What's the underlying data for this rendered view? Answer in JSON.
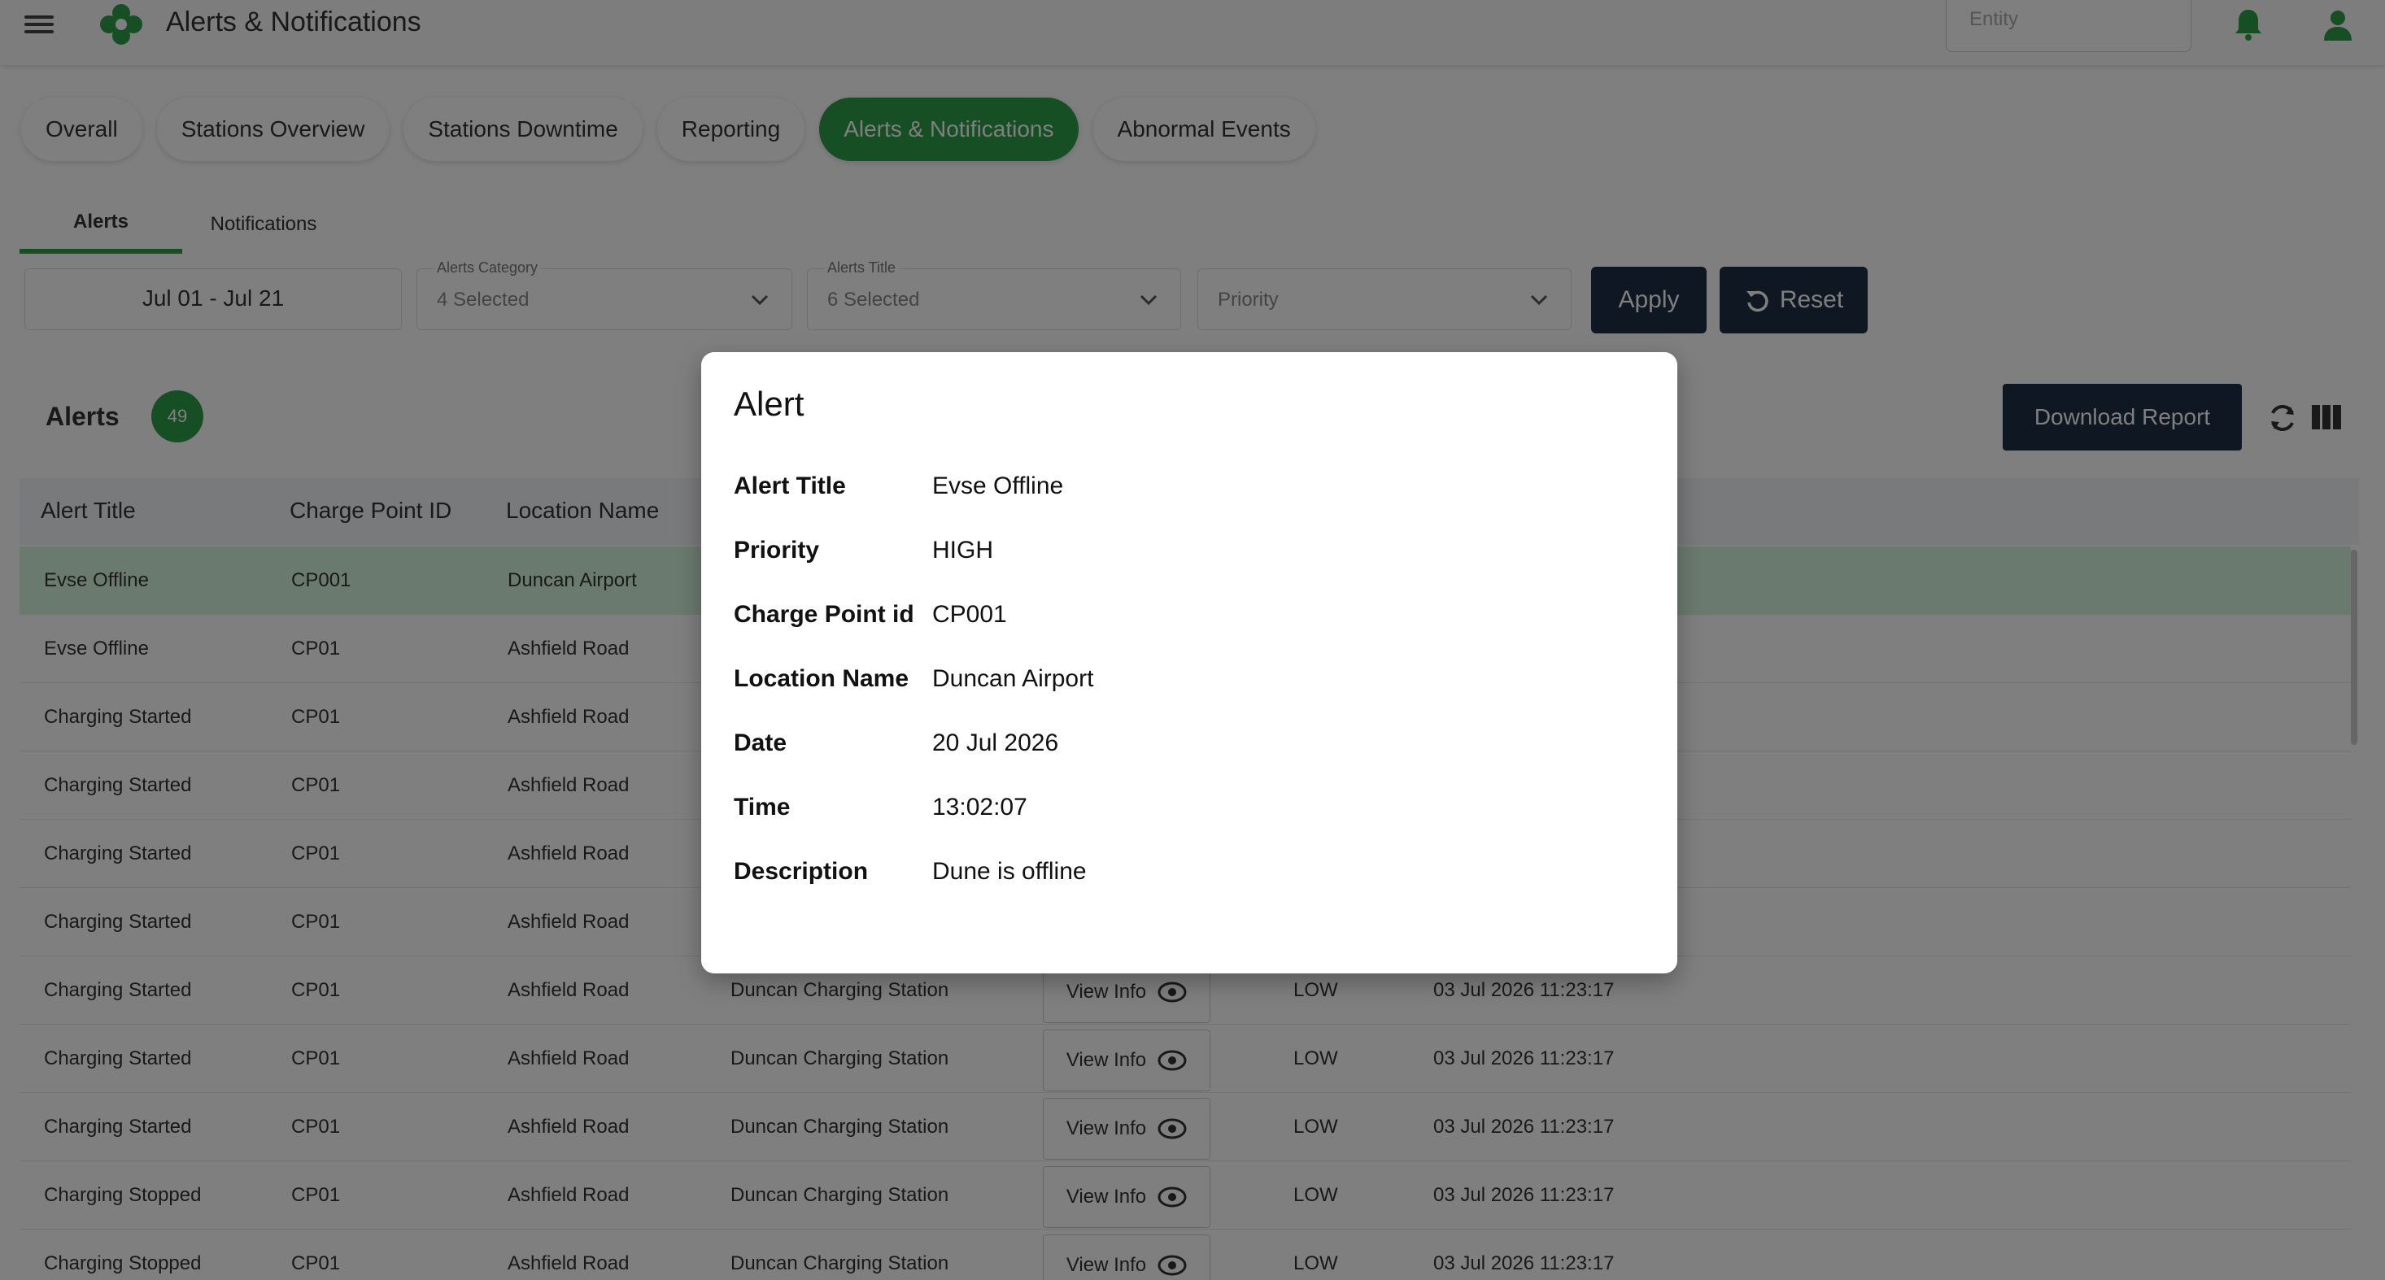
{
  "header": {
    "app_title": "Alerts & Notifications",
    "entity_placeholder": "Entity"
  },
  "main_tabs": [
    {
      "label": "Overall"
    },
    {
      "label": "Stations Overview"
    },
    {
      "label": "Stations Downtime"
    },
    {
      "label": "Reporting"
    },
    {
      "label": "Alerts & Notifications",
      "active": true
    },
    {
      "label": "Abnormal Events"
    }
  ],
  "sub_tabs": [
    {
      "label": "Alerts",
      "active": true
    },
    {
      "label": "Notifications"
    }
  ],
  "filters": {
    "date_range": "Jul 01 - Jul 21",
    "alerts_category_label": "Alerts Category",
    "alerts_category_value": "4 Selected",
    "alerts_title_label": "Alerts Title",
    "alerts_title_value": "6 Selected",
    "priority_placeholder": "Priority",
    "apply_label": "Apply",
    "reset_label": "Reset"
  },
  "alerts_panel": {
    "title": "Alerts",
    "count": "49",
    "download_label": "Download Report"
  },
  "table": {
    "columns": [
      "Alert Title",
      "Charge Point ID",
      "Location Name"
    ],
    "view_info_label": "View Info",
    "rows": [
      {
        "title": "Evse Offline",
        "cp": "CP001",
        "location": "Duncan Airport",
        "station": "",
        "priority": "",
        "datetime": "",
        "highlight": true
      },
      {
        "title": "Evse Offline",
        "cp": "CP01",
        "location": "Ashfield Road",
        "station": "",
        "priority": "",
        "datetime": ""
      },
      {
        "title": "Charging Started",
        "cp": "CP01",
        "location": "Ashfield Road",
        "station": "",
        "priority": "",
        "datetime": ""
      },
      {
        "title": "Charging Started",
        "cp": "CP01",
        "location": "Ashfield Road",
        "station": "",
        "priority": "",
        "datetime": ""
      },
      {
        "title": "Charging Started",
        "cp": "CP01",
        "location": "Ashfield Road",
        "station": "",
        "priority": "",
        "datetime": ""
      },
      {
        "title": "Charging Started",
        "cp": "CP01",
        "location": "Ashfield Road",
        "station": "",
        "priority": "",
        "datetime": ""
      },
      {
        "title": "Charging Started",
        "cp": "CP01",
        "location": "Ashfield Road",
        "station": "Duncan Charging Station",
        "priority": "LOW",
        "datetime": "03 Jul 2026 11:23:17"
      },
      {
        "title": "Charging Started",
        "cp": "CP01",
        "location": "Ashfield Road",
        "station": "Duncan Charging Station",
        "priority": "LOW",
        "datetime": "03 Jul 2026 11:23:17"
      },
      {
        "title": "Charging Started",
        "cp": "CP01",
        "location": "Ashfield Road",
        "station": "Duncan Charging Station",
        "priority": "LOW",
        "datetime": "03 Jul 2026 11:23:17"
      },
      {
        "title": "Charging Stopped",
        "cp": "CP01",
        "location": "Ashfield Road",
        "station": "Duncan Charging Station",
        "priority": "LOW",
        "datetime": "03 Jul 2026 11:23:17"
      },
      {
        "title": "Charging Stopped",
        "cp": "CP01",
        "location": "Ashfield Road",
        "station": "Duncan Charging Station",
        "priority": "LOW",
        "datetime": "03 Jul 2026 11:23:17"
      }
    ]
  },
  "modal": {
    "title": "Alert",
    "fields": [
      {
        "label": "Alert Title",
        "value": "Evse Offline"
      },
      {
        "label": "Priority",
        "value": "HIGH"
      },
      {
        "label": "Charge Point id",
        "value": "CP001"
      },
      {
        "label": "Location Name",
        "value": "Duncan Airport"
      },
      {
        "label": "Date",
        "value": "20 Jul 2026"
      },
      {
        "label": "Time",
        "value": "13:02:07"
      },
      {
        "label": "Description",
        "value": "Dune is offline"
      }
    ]
  },
  "colors": {
    "accent": "#2e9e4a",
    "dark_button": "#1f3044",
    "highlight_row": "#d6f5dd"
  }
}
